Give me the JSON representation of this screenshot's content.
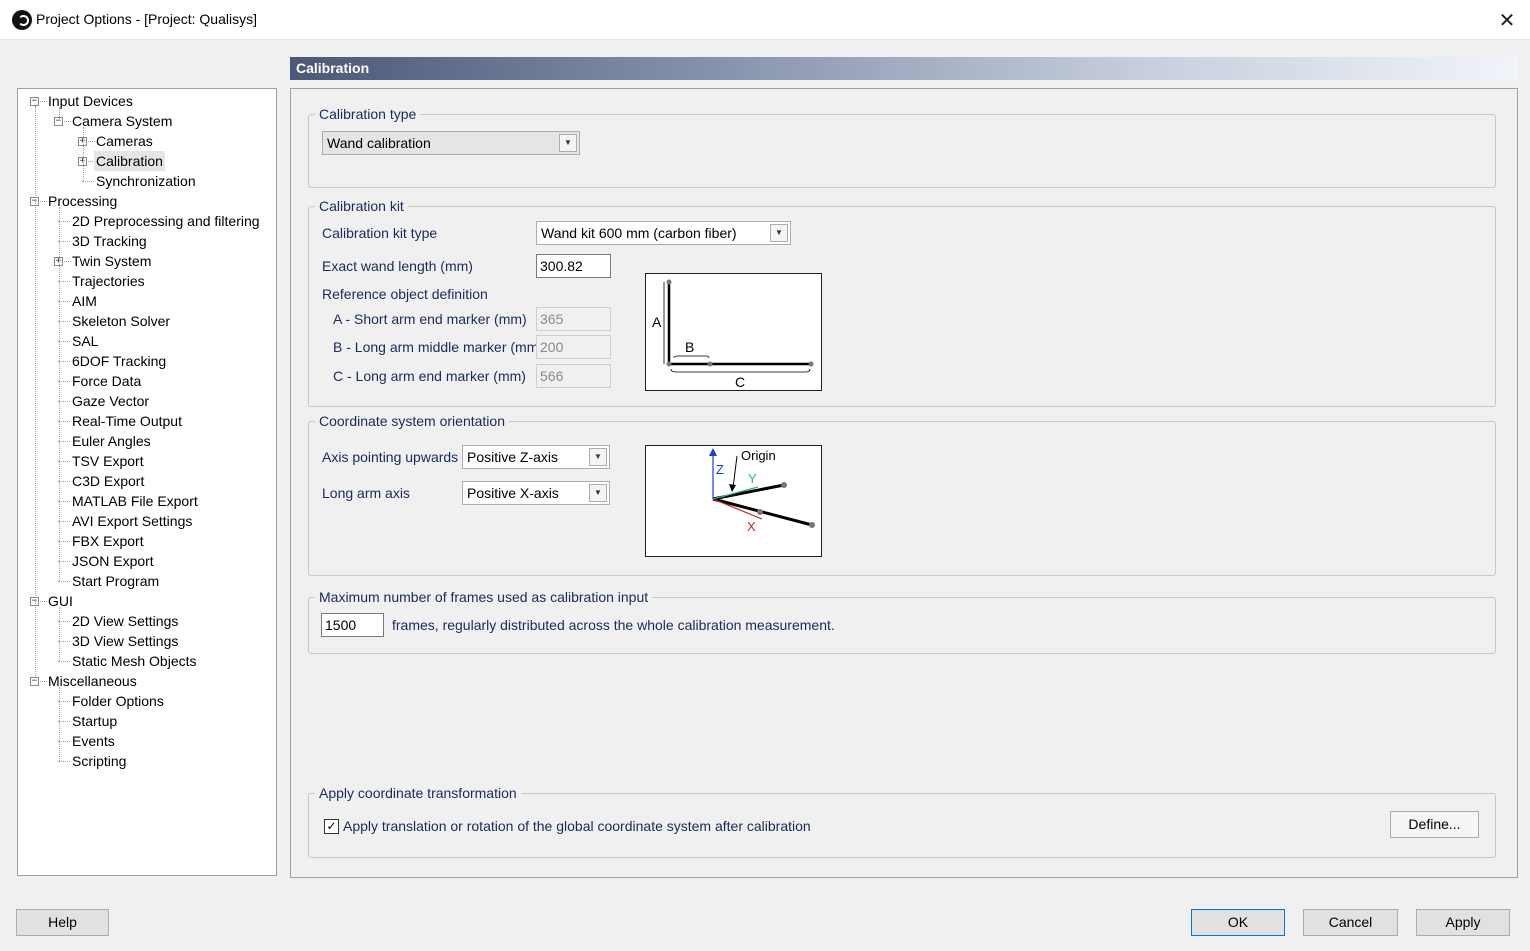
{
  "window": {
    "title": "Project Options - [Project: Qualisys]"
  },
  "tree": {
    "nodes": [
      {
        "label": "Input Devices",
        "level": 0,
        "expander": "−"
      },
      {
        "label": "Camera System",
        "level": 1,
        "expander": "−"
      },
      {
        "label": "Cameras",
        "level": 2,
        "expander": "+"
      },
      {
        "label": "Calibration",
        "level": 2,
        "expander": "+",
        "selected": true
      },
      {
        "label": "Synchronization",
        "level": 2,
        "expander": ""
      },
      {
        "label": "Processing",
        "level": 0,
        "expander": "−"
      },
      {
        "label": "2D Preprocessing and filtering",
        "level": 1,
        "expander": ""
      },
      {
        "label": "3D Tracking",
        "level": 1,
        "expander": ""
      },
      {
        "label": "Twin System",
        "level": 1,
        "expander": "+"
      },
      {
        "label": "Trajectories",
        "level": 1,
        "expander": ""
      },
      {
        "label": "AIM",
        "level": 1,
        "expander": ""
      },
      {
        "label": "Skeleton Solver",
        "level": 1,
        "expander": ""
      },
      {
        "label": "SAL",
        "level": 1,
        "expander": ""
      },
      {
        "label": "6DOF Tracking",
        "level": 1,
        "expander": ""
      },
      {
        "label": "Force Data",
        "level": 1,
        "expander": ""
      },
      {
        "label": "Gaze Vector",
        "level": 1,
        "expander": ""
      },
      {
        "label": "Real-Time Output",
        "level": 1,
        "expander": ""
      },
      {
        "label": "Euler Angles",
        "level": 1,
        "expander": ""
      },
      {
        "label": "TSV Export",
        "level": 1,
        "expander": ""
      },
      {
        "label": "C3D Export",
        "level": 1,
        "expander": ""
      },
      {
        "label": "MATLAB File Export",
        "level": 1,
        "expander": ""
      },
      {
        "label": "AVI Export Settings",
        "level": 1,
        "expander": ""
      },
      {
        "label": "FBX Export",
        "level": 1,
        "expander": ""
      },
      {
        "label": "JSON Export",
        "level": 1,
        "expander": ""
      },
      {
        "label": "Start Program",
        "level": 1,
        "expander": ""
      },
      {
        "label": "GUI",
        "level": 0,
        "expander": "−"
      },
      {
        "label": "2D View Settings",
        "level": 1,
        "expander": ""
      },
      {
        "label": "3D View Settings",
        "level": 1,
        "expander": ""
      },
      {
        "label": "Static Mesh Objects",
        "level": 1,
        "expander": ""
      },
      {
        "label": "Miscellaneous",
        "level": 0,
        "expander": "−"
      },
      {
        "label": "Folder Options",
        "level": 1,
        "expander": ""
      },
      {
        "label": "Startup",
        "level": 1,
        "expander": ""
      },
      {
        "label": "Events",
        "level": 1,
        "expander": ""
      },
      {
        "label": "Scripting",
        "level": 1,
        "expander": ""
      }
    ]
  },
  "section": {
    "header": "Calibration"
  },
  "calibration_type": {
    "title": "Calibration type",
    "selected": "Wand calibration"
  },
  "calibration_kit": {
    "title": "Calibration kit",
    "kit_type_label": "Calibration kit type",
    "kit_type_value": "Wand kit 600 mm (carbon fiber)",
    "wand_length_label": "Exact wand length (mm)",
    "wand_length_value": "300.82",
    "ref_def_label": "Reference object definition",
    "a_label": "A - Short arm end marker (mm)",
    "a_value": "365",
    "b_label": "B - Long arm middle marker (mm)",
    "b_value": "200",
    "c_label": "C - Long arm end marker (mm)",
    "c_value": "566",
    "diagram_labels": {
      "a": "A",
      "b": "B",
      "c": "C"
    }
  },
  "coordinate_system": {
    "title": "Coordinate system orientation",
    "axis_up_label": "Axis pointing upwards",
    "axis_up_value": "Positive Z-axis",
    "long_arm_label": "Long arm axis",
    "long_arm_value": "Positive X-axis",
    "diagram_labels": {
      "origin": "Origin",
      "z": "Z",
      "y": "Y",
      "x": "X"
    },
    "colors": {
      "z": "#1f3fd1",
      "y": "#2fb37a",
      "x": "#d02020"
    }
  },
  "max_frames": {
    "title": "Maximum number of frames used as calibration input",
    "value": "1500",
    "suffix": "frames, regularly distributed across the whole calibration measurement."
  },
  "transform": {
    "title": "Apply coordinate transformation",
    "checkbox_label": "Apply translation or rotation of the global coordinate system after calibration",
    "checked": true,
    "check_glyph": "✓",
    "define_label": "Define..."
  },
  "footer": {
    "help_label": "Help",
    "ok_label": "OK",
    "cancel_label": "Cancel",
    "apply_label": "Apply"
  }
}
